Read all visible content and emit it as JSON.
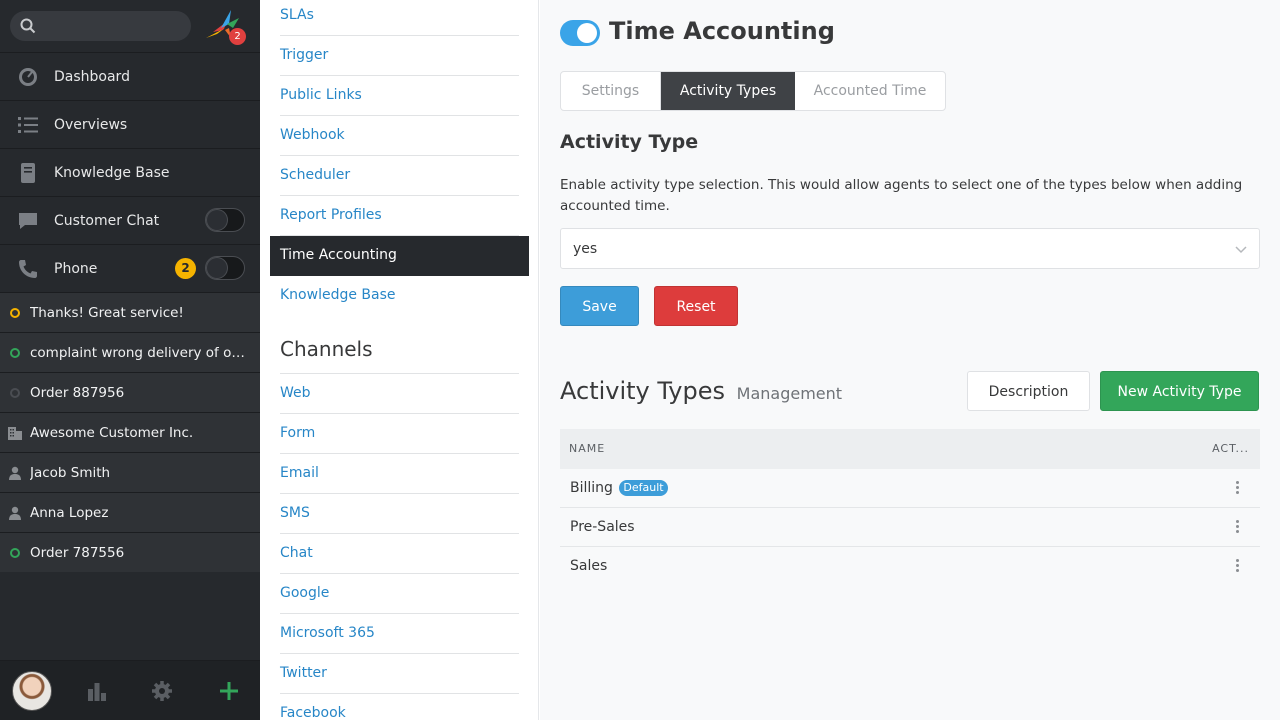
{
  "nav": {
    "logo_badge": "2",
    "items": [
      {
        "label": "Dashboard"
      },
      {
        "label": "Overviews"
      },
      {
        "label": "Knowledge Base"
      },
      {
        "label": "Customer Chat"
      },
      {
        "label": "Phone"
      }
    ],
    "phone_badge": "2",
    "tasks": [
      {
        "label": "Thanks! Great service!",
        "status_color": "#f5b300",
        "icon": "ticket-open-ring"
      },
      {
        "label": "complaint wrong delivery of ord...",
        "status_color": "#33a65a",
        "icon": "ticket-new-ring"
      },
      {
        "label": "Order 887956",
        "status_color": "#4a4d52",
        "icon": "ticket-closed-ring"
      },
      {
        "label": "Awesome Customer Inc.",
        "icon": "organization-icon"
      },
      {
        "label": "Jacob Smith",
        "icon": "user-icon"
      },
      {
        "label": "Anna Lopez",
        "icon": "user-icon"
      },
      {
        "label": "Order 787556",
        "status_color": "#33a65a",
        "icon": "ticket-new-ring"
      }
    ]
  },
  "subnav": {
    "items": [
      "SLAs",
      "Trigger",
      "Public Links",
      "Webhook",
      "Scheduler",
      "Report Profiles",
      "Time Accounting",
      "Knowledge Base"
    ],
    "active": "Time Accounting",
    "channels_heading": "Channels",
    "channels": [
      "Web",
      "Form",
      "Email",
      "SMS",
      "Chat",
      "Google",
      "Microsoft 365",
      "Twitter",
      "Facebook"
    ]
  },
  "main": {
    "title": "Time Accounting",
    "tabs": [
      "Settings",
      "Activity Types",
      "Accounted Time"
    ],
    "active_tab": "Activity Types",
    "section_title": "Activity Type",
    "description": "Enable activity type selection. This would allow agents to select one of the types below when adding accounted time.",
    "select_value": "yes",
    "save_label": "Save",
    "reset_label": "Reset",
    "mgmt_title": "Activity Types",
    "mgmt_subtitle": "Management",
    "description_button": "Description",
    "new_button": "New Activity Type",
    "table": {
      "col_name": "NAME",
      "col_actions": "ACT...",
      "rows": [
        {
          "name": "Billing",
          "badge": "Default"
        },
        {
          "name": "Pre-Sales"
        },
        {
          "name": "Sales"
        }
      ]
    }
  }
}
